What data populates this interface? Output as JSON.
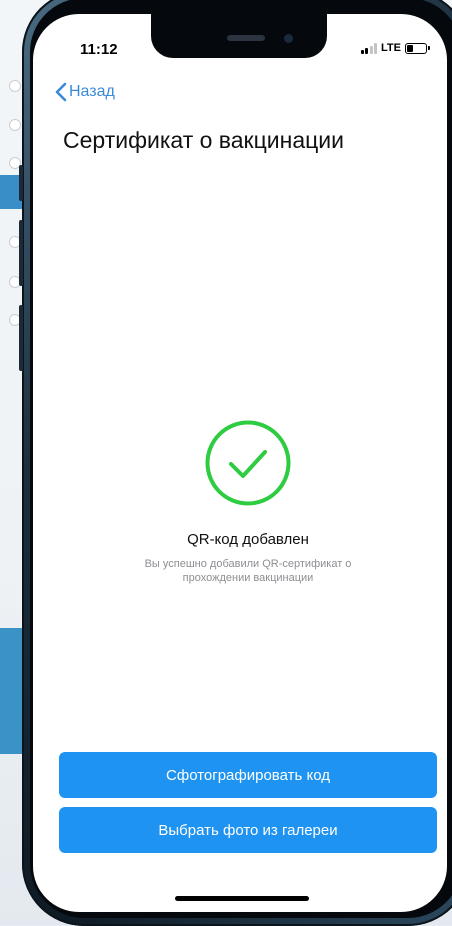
{
  "status_bar": {
    "time": "11:12",
    "network": "LTE"
  },
  "nav": {
    "back_label": "Назад"
  },
  "page": {
    "title": "Сертификат о вакцинации"
  },
  "result": {
    "title": "QR-код добавлен",
    "description": "Вы успешно добавили QR-сертификат о прохождении вакцинации"
  },
  "actions": {
    "take_photo_label": "Сфотографировать код",
    "choose_gallery_label": "Выбрать фото из галереи"
  },
  "colors": {
    "accent": "#1f93f2",
    "link": "#3b8bd9",
    "success": "#2ecc40"
  },
  "icons": {
    "back": "chevron-left-icon",
    "success": "check-circle-icon"
  }
}
